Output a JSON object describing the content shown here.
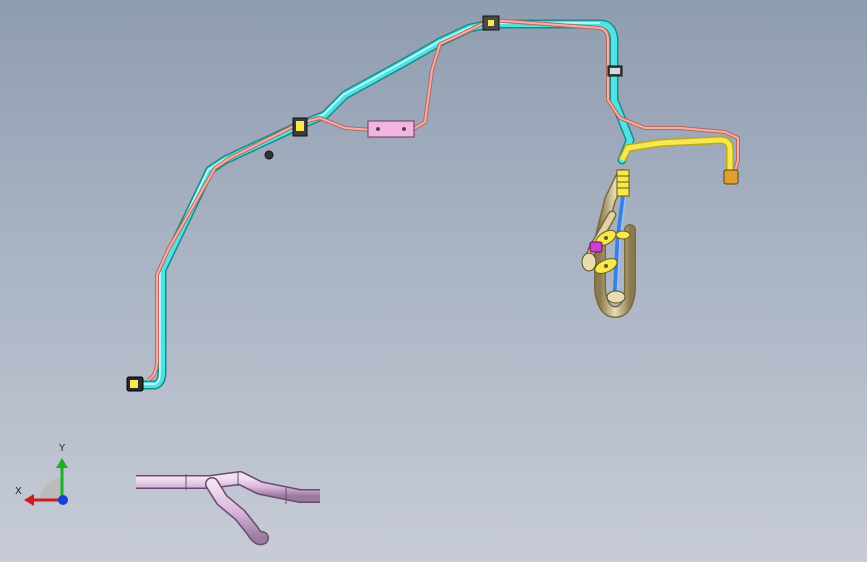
{
  "window": {
    "title": ""
  },
  "view": {
    "background_top": "#8f9db0",
    "background_bottom": "#c7ccd6"
  },
  "triad": {
    "x_label": "X",
    "y_label": "Y",
    "x_color": "#d11a1a",
    "y_color": "#1fae2a",
    "z_color": "#1a3fd6"
  },
  "parts": {
    "tube_cyan": "#3fd9d9",
    "tube_pink": "#e89a90",
    "tube_yellow": "#f2e24a",
    "tube_beige": "#d7c79a",
    "tube_blue": "#3b7fe0",
    "tube_magenta": "#d040d0",
    "tube_lavender": "#d9b6dc",
    "bracket_pink": "#f0b6e0"
  }
}
